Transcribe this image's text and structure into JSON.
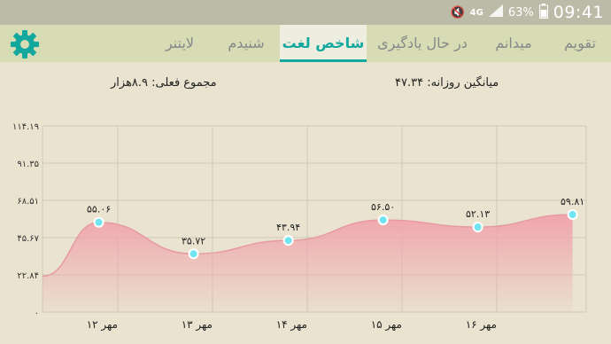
{
  "status_bar": {
    "network": "4G",
    "battery": "63%",
    "time": "09:41"
  },
  "tabs": [
    {
      "label": "تقویم"
    },
    {
      "label": "میدانم"
    },
    {
      "label": "در حال یادگیری"
    },
    {
      "label": "شاخص لغت",
      "active": true
    },
    {
      "label": "شنیدم"
    },
    {
      "label": "لایتنر"
    }
  ],
  "summary": {
    "daily_average": "میانگین روزانه: ۴۷.۳۴",
    "current_total": "مجموع فعلی: ۸.۹هزار"
  },
  "colors": {
    "accent": "#13a89e",
    "area_fill": "#f0a5ad",
    "line": "#e79aa3",
    "point": "#6fe5f2"
  },
  "chart_data": {
    "type": "area",
    "categories": [
      "۱۲ مهر",
      "۱۳ مهر",
      "۱۴ مهر",
      "۱۵ مهر",
      "۱۶ مهر"
    ],
    "y_tick_labels": [
      "۰",
      "۲۲.۸۴",
      "۴۵.۶۷",
      "۶۸.۵۱",
      "۹۱.۳۵",
      "۱۱۴.۱۹"
    ],
    "y_ticks": [
      0,
      22.84,
      45.67,
      68.51,
      91.35,
      114.19
    ],
    "ylim": [
      0,
      114.19
    ],
    "points": [
      {
        "x": 0.8,
        "y": 55.06,
        "label": "۵۵.۰۶"
      },
      {
        "x": 1.8,
        "y": 35.72,
        "label": "۳۵.۷۲"
      },
      {
        "x": 2.8,
        "y": 43.94,
        "label": "۴۳.۹۴"
      },
      {
        "x": 3.8,
        "y": 56.5,
        "label": "۵۶.۵۰"
      },
      {
        "x": 4.8,
        "y": 52.13,
        "label": "۵۲.۱۳"
      },
      {
        "x": 5.8,
        "y": 59.81,
        "label": "۵۹.۸۱"
      }
    ],
    "start_y": 22,
    "grid": true
  }
}
